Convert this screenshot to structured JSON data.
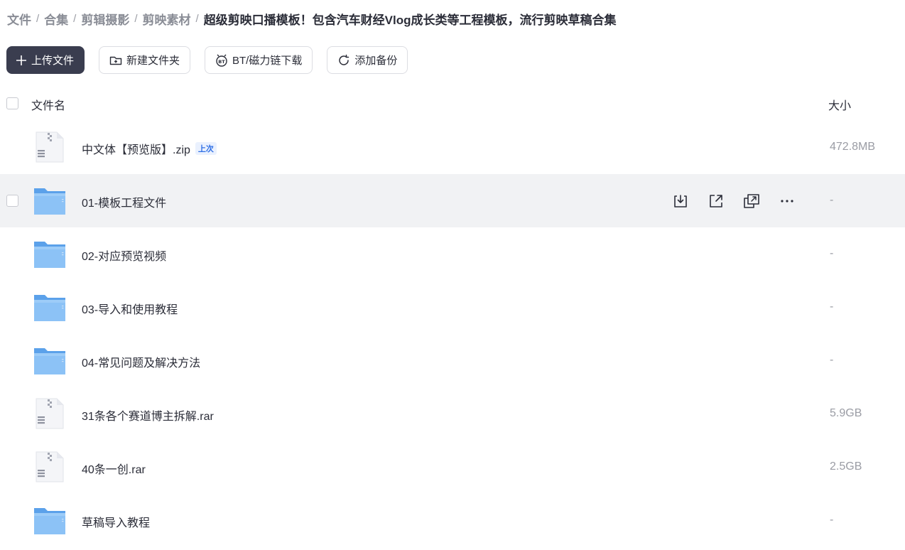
{
  "breadcrumb": {
    "items": [
      "文件",
      "合集",
      "剪辑摄影",
      "剪映素材"
    ],
    "current": "超级剪映口播模板！包含汽车财经Vlog成长类等工程模板，流行剪映草稿合集"
  },
  "toolbar": {
    "upload_label": "上传文件",
    "new_folder_label": "新建文件夹",
    "bt_label": "BT/磁力链下载",
    "backup_label": "添加备份"
  },
  "table": {
    "col_name": "文件名",
    "col_size": "大小"
  },
  "files": [
    {
      "name": "中文体【预览版】.zip",
      "type": "zip",
      "size": "472.8MB",
      "tag": "上次"
    },
    {
      "name": "01-模板工程文件",
      "type": "folder",
      "size": "-"
    },
    {
      "name": "02-对应预览视频",
      "type": "folder",
      "size": "-"
    },
    {
      "name": "03-导入和使用教程",
      "type": "folder",
      "size": "-"
    },
    {
      "name": "04-常见问题及解决方法",
      "type": "folder",
      "size": "-"
    },
    {
      "name": "31条各个赛道博主拆解.rar",
      "type": "zip",
      "size": "5.9GB"
    },
    {
      "name": "40条一创.rar",
      "type": "zip",
      "size": "2.5GB"
    },
    {
      "name": "草稿导入教程",
      "type": "folder",
      "size": "-"
    }
  ],
  "icons": {
    "folder": "folder-icon",
    "zip": "zip-file-icon",
    "download": "download-icon",
    "share": "share-icon",
    "copy_link": "copy-link-icon",
    "more": "more-icon"
  },
  "colors": {
    "primary_button": "#3a3d4f",
    "folder": "#6aaef0",
    "tag": "#2f6fe5",
    "hover_row": "#f1f2f4"
  }
}
